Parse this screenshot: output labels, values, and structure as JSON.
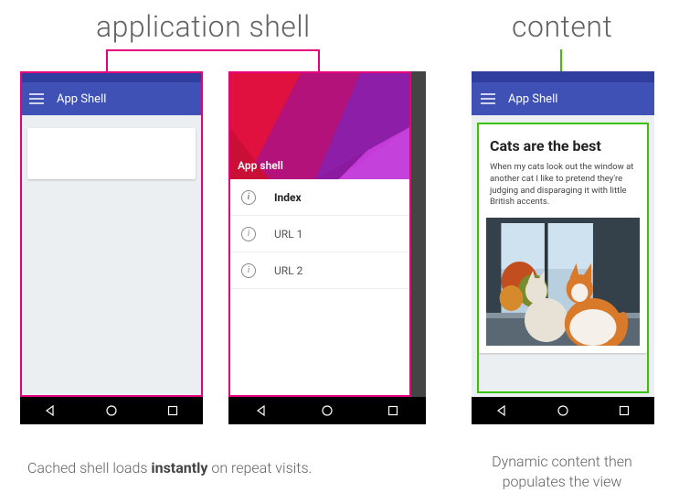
{
  "headings": {
    "appshell": "application shell",
    "content": "content"
  },
  "phone1": {
    "appbar_title": "App Shell"
  },
  "phone2": {
    "hero_title": "App shell",
    "nav_items": [
      {
        "label": "Index",
        "active": true
      },
      {
        "label": "URL 1",
        "active": false
      },
      {
        "label": "URL 2",
        "active": false
      }
    ]
  },
  "phone3": {
    "appbar_title": "App Shell",
    "content_title": "Cats are the best",
    "content_body": "When my cats look out the window at another cat I like to pretend they're judging and disparaging it with little British accents."
  },
  "captions": {
    "left_pre": "Cached shell loads ",
    "left_bold": "instantly",
    "left_post": " on repeat visits.",
    "right": "Dynamic content then populates the view"
  }
}
